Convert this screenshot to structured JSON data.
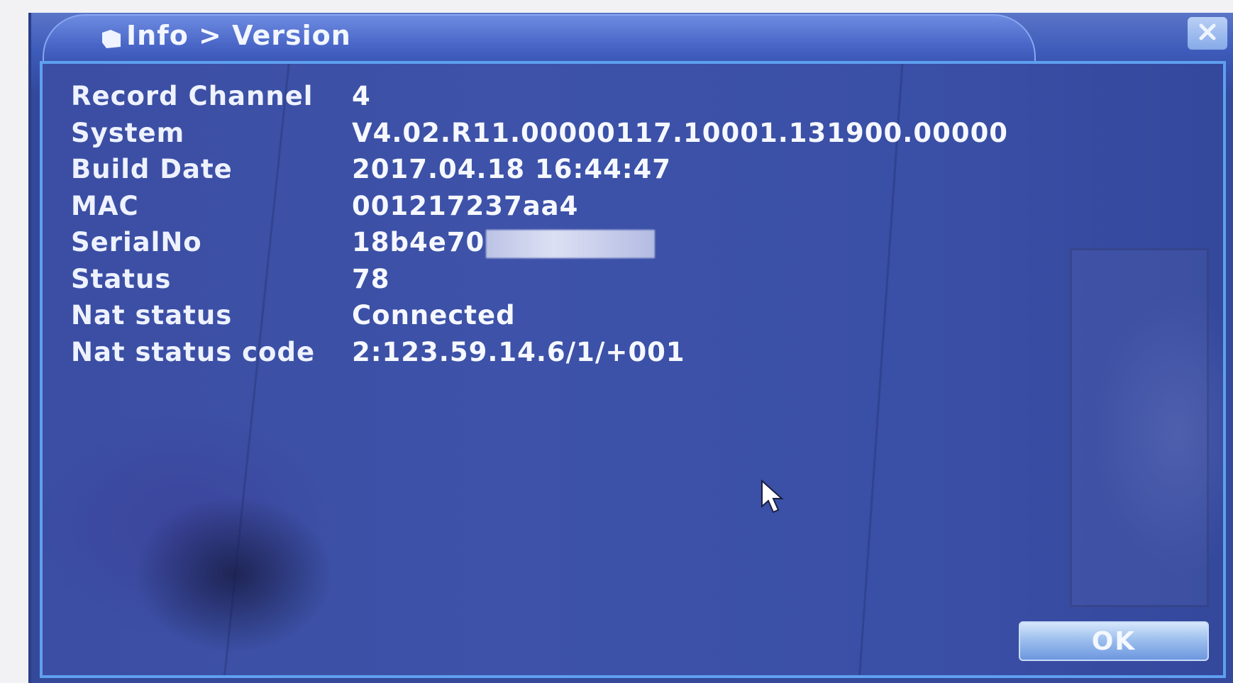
{
  "dialog": {
    "title": "Info > Version",
    "close_icon": "close-icon",
    "ok_label": "OK"
  },
  "info": {
    "rows": [
      {
        "label": "Record Channel",
        "value": "4"
      },
      {
        "label": "System",
        "value": "V4.02.R11.00000117.10001.131900.00000"
      },
      {
        "label": "Build Date",
        "value": "2017.04.18 16:44:47"
      },
      {
        "label": "MAC",
        "value": "001217237aa4"
      },
      {
        "label": "SerialNo",
        "value": "18b4e70"
      },
      {
        "label": "Status",
        "value": "78"
      },
      {
        "label": "Nat status",
        "value": "Connected"
      },
      {
        "label": "Nat status code",
        "value": "2:123.59.14.6/1/+001"
      }
    ]
  },
  "colors": {
    "panel_bg": "#3b4ea3",
    "panel_border": "#5fa0f0",
    "title_tab": "#4a67c8",
    "text": "#f2f6ff"
  }
}
